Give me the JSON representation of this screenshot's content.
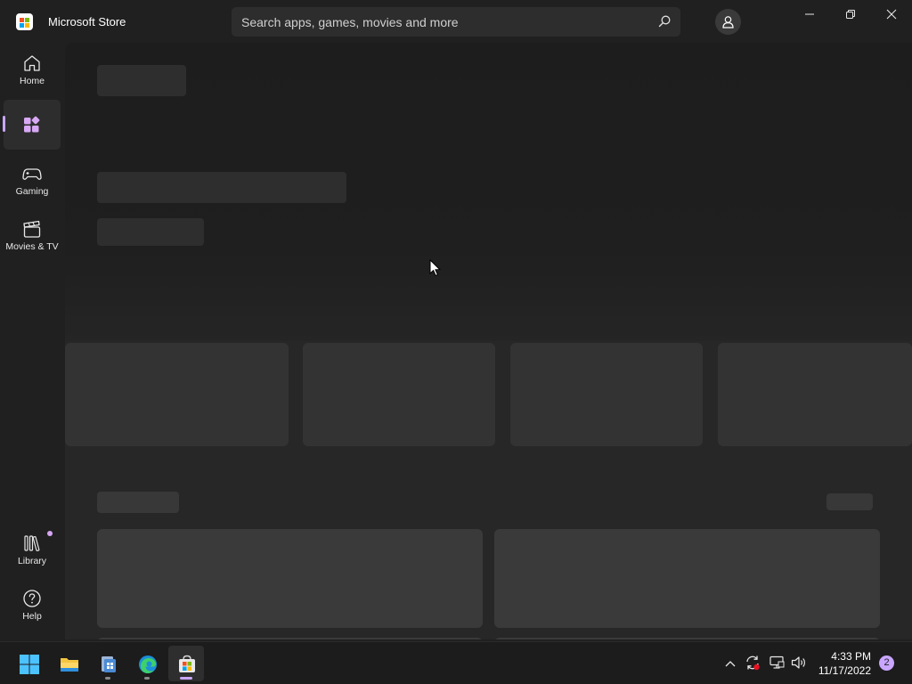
{
  "window": {
    "title": "Microsoft Store",
    "controls": [
      "minimize-icon",
      "restore-icon",
      "close-icon"
    ]
  },
  "search": {
    "placeholder": "Search apps, games, movies and more",
    "icon": "search-icon"
  },
  "account": {
    "icon": "account-icon"
  },
  "sidebar": {
    "items": [
      {
        "label": "Home",
        "icon": "home-icon",
        "active": false
      },
      {
        "label": "",
        "icon": "apps-icon",
        "active": true
      },
      {
        "label": "Gaming",
        "icon": "gamepad-icon",
        "active": false
      },
      {
        "label": "Movies & TV",
        "icon": "clapperboard-icon",
        "active": false
      }
    ],
    "bottom": [
      {
        "label": "Library",
        "icon": "library-icon",
        "has_badge": true
      },
      {
        "label": "Help",
        "icon": "help-icon"
      }
    ]
  },
  "content": {
    "state": "loading",
    "placeholders": "skeleton blocks"
  },
  "taskbar": {
    "apps": [
      {
        "icon": "windows-start-icon",
        "active": false
      },
      {
        "icon": "file-explorer-icon",
        "active": false
      },
      {
        "icon": "windows-installer-icon",
        "active": false
      },
      {
        "icon": "edge-icon",
        "active": false
      },
      {
        "icon": "microsoft-store-icon",
        "active": true
      }
    ],
    "tray": [
      "chevron-up-icon",
      "sync-icon",
      "network-icon",
      "volume-icon"
    ],
    "time": "4:33 PM",
    "date": "11/17/2022",
    "notifications": "2"
  },
  "colors": {
    "accent": "#c9a6ff",
    "background": "#202020",
    "content": "#272727"
  }
}
